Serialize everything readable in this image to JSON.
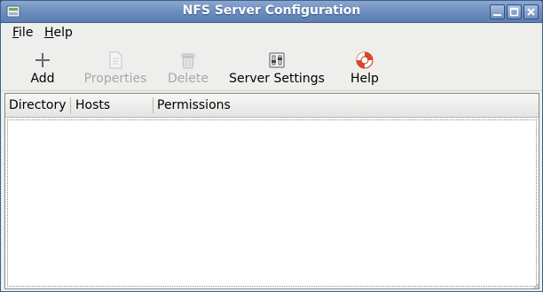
{
  "window": {
    "title": "NFS Server Configuration"
  },
  "menu": [
    {
      "mnemonic": "F",
      "rest": "ile"
    },
    {
      "mnemonic": "H",
      "rest": "elp"
    }
  ],
  "toolbar": {
    "add": {
      "label": "Add",
      "enabled": true,
      "icon": "plus-icon"
    },
    "properties": {
      "label": "Properties",
      "enabled": false,
      "icon": "properties-icon"
    },
    "delete": {
      "label": "Delete",
      "enabled": false,
      "icon": "trash-icon"
    },
    "server_settings": {
      "label": "Server Settings",
      "enabled": true,
      "icon": "settings-icon"
    },
    "help": {
      "label": "Help",
      "enabled": true,
      "icon": "lifebuoy-icon"
    }
  },
  "table": {
    "columns": [
      "Directory",
      "Hosts",
      "Permissions"
    ],
    "rows": []
  },
  "colors": {
    "titlebar": "#6f8fbf",
    "window_bg": "#eeeeec",
    "disabled_text": "#a8a8a8"
  }
}
